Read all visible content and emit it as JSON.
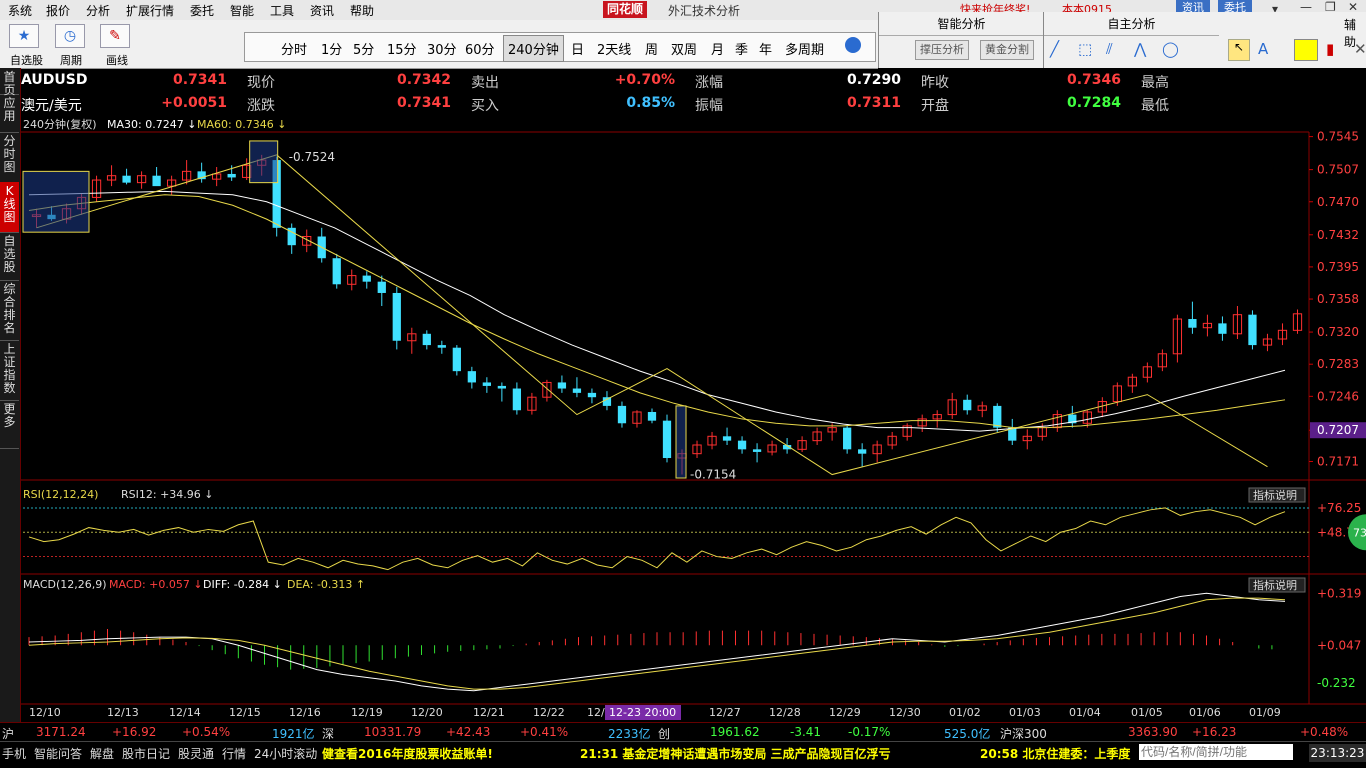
{
  "menu": [
    "系统",
    "报价",
    "分析",
    "扩展行情",
    "委托",
    "智能",
    "工具",
    "资讯",
    "帮助"
  ],
  "app": {
    "logo": "同花顺",
    "title": "外汇技术分析"
  },
  "marquee": "快来抢年终奖!",
  "top_right": {
    "user": "本本0915",
    "news": "资讯",
    "trade": "委托"
  },
  "toolbar": {
    "watchlist": "自选股",
    "cycle": "周期",
    "draw": "画线"
  },
  "periods": [
    "分时",
    "1分",
    "5分",
    "15分",
    "30分",
    "60分",
    "240分钟",
    "日",
    "2天线",
    "周",
    "双周",
    "月",
    "季",
    "年",
    "多周期"
  ],
  "active_period": "240分钟",
  "smart_panel": {
    "title": "智能分析",
    "btn1": "撑压分析",
    "btn2": "黄金分割"
  },
  "self_panel": {
    "title": "自主分析",
    "right": "辅助"
  },
  "side_tabs": [
    {
      "label": "首页",
      "active": false
    },
    {
      "label": "应用",
      "active": false
    },
    {
      "label": "分时图",
      "active": false
    },
    {
      "label": "K线图",
      "active": true
    },
    {
      "label": "自选股",
      "active": false
    },
    {
      "label": "综合排名",
      "active": false
    },
    {
      "label": "上证指数",
      "active": false
    },
    {
      "label": "更多",
      "active": false
    }
  ],
  "quote": {
    "symbol": "AUDUSD",
    "name": "澳元/美元",
    "row1": [
      {
        "label": "现价",
        "value": "0.7341",
        "color": "#ff4040"
      },
      {
        "label": "卖出",
        "value": "0.7342",
        "color": "#ff4040"
      },
      {
        "label": "涨幅",
        "value": "+0.70%",
        "color": "#ff4040"
      },
      {
        "label": "昨收",
        "value": "0.7290",
        "color": "#ffffff"
      },
      {
        "label": "最高",
        "value": "0.7346",
        "color": "#ff4040"
      }
    ],
    "row2": [
      {
        "label": "涨跌",
        "value": "+0.0051",
        "color": "#ff4040"
      },
      {
        "label": "买入",
        "value": "0.7341",
        "color": "#ff4040"
      },
      {
        "label": "振幅",
        "value": "0.85%",
        "color": "#40c0ff"
      },
      {
        "label": "开盘",
        "value": "0.7311",
        "color": "#ff4040"
      },
      {
        "label": "最低",
        "value": "0.7284",
        "color": "#40ff40"
      }
    ]
  },
  "chart_info": {
    "period_label": "240分钟(复权)",
    "ma30_label": "MA30: 0.7247",
    "ma60_label": "MA60: 0.7346",
    "high_annot": "0.7524",
    "low_annot": "0.7154",
    "current_tag": "0.7207",
    "price_ticks": [
      "0.7545",
      "0.7507",
      "0.7470",
      "0.7432",
      "0.7395",
      "0.7358",
      "0.7320",
      "0.7283",
      "0.7246",
      "0.7207",
      "0.7171"
    ],
    "rsi_label": "RSI(12,12,24)",
    "rsi12_label": "RSI12: +34.96",
    "rsi_ticks": [
      "+76.25",
      "+48.78"
    ],
    "rsi_bubble": "73",
    "macd_label": "MACD(12,26,9)",
    "macd_value": "MACD: +0.057",
    "diff": "DIFF: -0.284",
    "dea": "DEA: -0.313",
    "macd_ticks": [
      "+0.319",
      "+0.047",
      "-0.232"
    ],
    "indicator_btn": "指标说明",
    "dates": [
      "12/10",
      "12/13",
      "12/14",
      "12/15",
      "12/16",
      "12/19",
      "12/20",
      "12/21",
      "12/22",
      "12/2",
      "12/27",
      "12/28",
      "12/29",
      "12/30",
      "01/02",
      "01/03",
      "01/04",
      "01/05",
      "01/06",
      "01/09"
    ],
    "crosshair_date": "12-23 20:00"
  },
  "chart_data": {
    "type": "candlestick",
    "price_range": [
      0.7152,
      0.7548
    ],
    "candles": [
      [
        0.7453,
        0.7462,
        0.744,
        0.7455
      ],
      [
        0.7455,
        0.7465,
        0.7448,
        0.745
      ],
      [
        0.745,
        0.7468,
        0.7445,
        0.7462
      ],
      [
        0.7462,
        0.748,
        0.7455,
        0.7475
      ],
      [
        0.7475,
        0.75,
        0.747,
        0.7495
      ],
      [
        0.7495,
        0.7512,
        0.7488,
        0.75
      ],
      [
        0.75,
        0.7508,
        0.749,
        0.7492
      ],
      [
        0.7492,
        0.7505,
        0.7485,
        0.75
      ],
      [
        0.75,
        0.751,
        0.749,
        0.7488
      ],
      [
        0.7488,
        0.75,
        0.7478,
        0.7495
      ],
      [
        0.7495,
        0.7518,
        0.749,
        0.7505
      ],
      [
        0.7505,
        0.7515,
        0.7492,
        0.7496
      ],
      [
        0.7496,
        0.751,
        0.7488,
        0.7502
      ],
      [
        0.7502,
        0.7512,
        0.7494,
        0.7498
      ],
      [
        0.7498,
        0.752,
        0.7495,
        0.7512
      ],
      [
        0.7512,
        0.7524,
        0.75,
        0.7518
      ],
      [
        0.7518,
        0.7522,
        0.743,
        0.744
      ],
      [
        0.744,
        0.7445,
        0.741,
        0.742
      ],
      [
        0.742,
        0.7438,
        0.7412,
        0.743
      ],
      [
        0.743,
        0.744,
        0.74,
        0.7405
      ],
      [
        0.7405,
        0.741,
        0.737,
        0.7375
      ],
      [
        0.7375,
        0.7392,
        0.7368,
        0.7385
      ],
      [
        0.7385,
        0.739,
        0.737,
        0.7378
      ],
      [
        0.7378,
        0.7385,
        0.735,
        0.7365
      ],
      [
        0.7365,
        0.7372,
        0.73,
        0.731
      ],
      [
        0.731,
        0.7325,
        0.7295,
        0.7318
      ],
      [
        0.7318,
        0.7322,
        0.73,
        0.7305
      ],
      [
        0.7305,
        0.731,
        0.7295,
        0.7302
      ],
      [
        0.7302,
        0.7305,
        0.727,
        0.7275
      ],
      [
        0.7275,
        0.728,
        0.7255,
        0.7262
      ],
      [
        0.7262,
        0.7268,
        0.725,
        0.7258
      ],
      [
        0.7258,
        0.7262,
        0.724,
        0.7255
      ],
      [
        0.7255,
        0.7262,
        0.7225,
        0.723
      ],
      [
        0.723,
        0.725,
        0.7225,
        0.7245
      ],
      [
        0.7245,
        0.7265,
        0.724,
        0.7262
      ],
      [
        0.7262,
        0.727,
        0.725,
        0.7255
      ],
      [
        0.7255,
        0.7268,
        0.7245,
        0.725
      ],
      [
        0.725,
        0.7255,
        0.7238,
        0.7245
      ],
      [
        0.7245,
        0.7252,
        0.723,
        0.7235
      ],
      [
        0.7235,
        0.724,
        0.721,
        0.7215
      ],
      [
        0.7215,
        0.723,
        0.721,
        0.7228
      ],
      [
        0.7228,
        0.7232,
        0.7215,
        0.7218
      ],
      [
        0.7218,
        0.7225,
        0.717,
        0.7175
      ],
      [
        0.7175,
        0.7185,
        0.7156,
        0.718
      ],
      [
        0.718,
        0.7195,
        0.7175,
        0.719
      ],
      [
        0.719,
        0.7205,
        0.7185,
        0.72
      ],
      [
        0.72,
        0.721,
        0.719,
        0.7195
      ],
      [
        0.7195,
        0.72,
        0.718,
        0.7185
      ],
      [
        0.7185,
        0.7192,
        0.717,
        0.7182
      ],
      [
        0.7182,
        0.7195,
        0.7178,
        0.719
      ],
      [
        0.719,
        0.7198,
        0.718,
        0.7185
      ],
      [
        0.7185,
        0.72,
        0.7182,
        0.7195
      ],
      [
        0.7195,
        0.721,
        0.719,
        0.7205
      ],
      [
        0.7205,
        0.7215,
        0.7195,
        0.721
      ],
      [
        0.721,
        0.7212,
        0.718,
        0.7185
      ],
      [
        0.7185,
        0.7192,
        0.7165,
        0.718
      ],
      [
        0.718,
        0.7195,
        0.717,
        0.719
      ],
      [
        0.719,
        0.7205,
        0.7185,
        0.72
      ],
      [
        0.72,
        0.7215,
        0.7195,
        0.7212
      ],
      [
        0.7212,
        0.7225,
        0.7205,
        0.722
      ],
      [
        0.722,
        0.723,
        0.721,
        0.7225
      ],
      [
        0.7225,
        0.725,
        0.722,
        0.7242
      ],
      [
        0.7242,
        0.7248,
        0.7225,
        0.723
      ],
      [
        0.723,
        0.724,
        0.7222,
        0.7235
      ],
      [
        0.7235,
        0.7238,
        0.7205,
        0.721
      ],
      [
        0.721,
        0.722,
        0.719,
        0.7195
      ],
      [
        0.7195,
        0.7208,
        0.7185,
        0.72
      ],
      [
        0.72,
        0.7215,
        0.7195,
        0.721
      ],
      [
        0.721,
        0.723,
        0.7205,
        0.7225
      ],
      [
        0.7225,
        0.7235,
        0.721,
        0.7215
      ],
      [
        0.7215,
        0.723,
        0.721,
        0.7228
      ],
      [
        0.7228,
        0.7245,
        0.7222,
        0.724
      ],
      [
        0.724,
        0.7262,
        0.7235,
        0.7258
      ],
      [
        0.7258,
        0.7272,
        0.725,
        0.7268
      ],
      [
        0.7268,
        0.7285,
        0.7262,
        0.728
      ],
      [
        0.728,
        0.73,
        0.7275,
        0.7295
      ],
      [
        0.7295,
        0.734,
        0.7285,
        0.7335
      ],
      [
        0.7335,
        0.7355,
        0.7318,
        0.7325
      ],
      [
        0.7325,
        0.734,
        0.7315,
        0.733
      ],
      [
        0.733,
        0.7338,
        0.731,
        0.7318
      ],
      [
        0.7318,
        0.735,
        0.7312,
        0.734
      ],
      [
        0.734,
        0.7345,
        0.73,
        0.7305
      ],
      [
        0.7305,
        0.7318,
        0.7298,
        0.7312
      ],
      [
        0.7312,
        0.733,
        0.7305,
        0.7322
      ],
      [
        0.7322,
        0.7346,
        0.7318,
        0.7341
      ]
    ],
    "ma30": [
      0.7478,
      0.7479,
      0.748,
      0.7481,
      0.7482,
      0.748,
      0.7478,
      0.747,
      0.7455,
      0.744,
      0.742,
      0.74,
      0.738,
      0.7362,
      0.734,
      0.7322,
      0.7305,
      0.729,
      0.7275,
      0.7262,
      0.7248,
      0.7238,
      0.7228,
      0.722,
      0.7214,
      0.721,
      0.721,
      0.7208,
      0.7206,
      0.7209,
      0.7212,
      0.7218,
      0.7226,
      0.7235,
      0.7246,
      0.7256,
      0.7266,
      0.7276
    ],
    "ma60": [
      0.746,
      0.7466,
      0.747,
      0.7474,
      0.7478,
      0.7476,
      0.7466,
      0.745,
      0.743,
      0.741,
      0.739,
      0.737,
      0.735,
      0.733,
      0.7312,
      0.7295,
      0.728,
      0.7265,
      0.725,
      0.7238,
      0.7228,
      0.722,
      0.7215,
      0.7212,
      0.7212,
      0.7215,
      0.7218,
      0.7218,
      0.7215,
      0.721,
      0.721,
      0.7212,
      0.7216,
      0.722,
      0.7225,
      0.723,
      0.7236,
      0.7242
    ],
    "rsi": [
      45,
      40,
      42,
      48,
      55,
      52,
      50,
      53,
      47,
      52,
      55,
      50,
      53,
      51,
      58,
      62,
      18,
      15,
      22,
      18,
      12,
      20,
      16,
      14,
      10,
      18,
      22,
      15,
      12,
      20,
      25,
      18,
      22,
      14,
      28,
      20,
      16,
      22,
      15,
      12,
      24,
      20,
      12,
      28,
      18,
      30,
      24,
      22,
      28,
      32,
      26,
      34,
      40,
      36,
      30,
      34,
      42,
      46,
      52,
      56,
      48,
      58,
      66,
      60,
      42,
      30,
      38,
      46,
      40,
      50,
      54,
      62,
      58,
      66,
      70,
      74,
      76,
      68,
      72,
      74,
      70,
      66,
      58,
      66,
      72
    ],
    "diff": [
      0.02,
      0.025,
      0.03,
      0.04,
      0.045,
      0.05,
      0.05,
      0.04,
      0.0,
      -0.05,
      -0.1,
      -0.15,
      -0.18,
      -0.2,
      -0.22,
      -0.25,
      -0.27,
      -0.28,
      -0.26,
      -0.24,
      -0.22,
      -0.2,
      -0.18,
      -0.16,
      -0.14,
      -0.12,
      -0.1,
      -0.08,
      -0.06,
      -0.04,
      -0.02,
      0.0,
      0.02,
      0.04,
      0.03,
      0.02,
      0.04,
      0.06,
      0.09,
      0.12,
      0.15,
      0.18,
      0.22,
      0.26,
      0.3,
      0.32,
      0.3,
      0.28,
      0.27
    ],
    "dea": [
      0.0,
      0.01,
      0.015,
      0.02,
      0.03,
      0.04,
      0.045,
      0.042,
      0.03,
      0.0,
      -0.04,
      -0.08,
      -0.12,
      -0.16,
      -0.19,
      -0.22,
      -0.25,
      -0.27,
      -0.27,
      -0.26,
      -0.24,
      -0.22,
      -0.2,
      -0.18,
      -0.16,
      -0.14,
      -0.12,
      -0.1,
      -0.08,
      -0.06,
      -0.04,
      -0.02,
      0.0,
      0.02,
      0.025,
      0.025,
      0.03,
      0.04,
      0.06,
      0.08,
      0.11,
      0.14,
      0.17,
      0.2,
      0.24,
      0.28,
      0.29,
      0.29,
      0.28
    ],
    "macd_hist": [
      0.05,
      0.06,
      0.08,
      0.1,
      0.08,
      0.05,
      0.02,
      -0.03,
      -0.08,
      -0.12,
      -0.15,
      -0.14,
      -0.12,
      -0.1,
      -0.08,
      -0.06,
      -0.04,
      -0.03,
      -0.02,
      0.01,
      0.03,
      0.05,
      0.06,
      0.07,
      0.08,
      0.08,
      0.09,
      0.09,
      0.09,
      0.08,
      0.07,
      0.06,
      0.05,
      0.04,
      0.02,
      -0.01,
      0.0,
      0.02,
      0.04,
      0.05,
      0.06,
      0.07,
      0.07,
      0.08,
      0.08,
      0.06,
      0.02,
      -0.02,
      -0.03
    ]
  },
  "index_bar": [
    {
      "t": "沪",
      "c": "#ddd"
    },
    {
      "t": "3171.24",
      "c": "#ff4040"
    },
    {
      "t": "+16.92",
      "c": "#ff4040"
    },
    {
      "t": "+0.54%",
      "c": "#ff4040"
    },
    {
      "t": "1921亿",
      "c": "#40c0ff"
    },
    {
      "t": "深",
      "c": "#ddd"
    },
    {
      "t": "10331.79",
      "c": "#ff4040"
    },
    {
      "t": "+42.43",
      "c": "#ff4040"
    },
    {
      "t": "+0.41%",
      "c": "#ff4040"
    },
    {
      "t": "2233亿",
      "c": "#40c0ff"
    },
    {
      "t": "创",
      "c": "#ddd"
    },
    {
      "t": "1961.62",
      "c": "#40ff40"
    },
    {
      "t": "-3.41",
      "c": "#40ff40"
    },
    {
      "t": "-0.17%",
      "c": "#40ff40"
    },
    {
      "t": "525.0亿",
      "c": "#40c0ff"
    },
    {
      "t": "沪深300",
      "c": "#ddd"
    },
    {
      "t": "3363.90",
      "c": "#ff4040"
    },
    {
      "t": "+16.23",
      "c": "#ff4040"
    },
    {
      "t": "+0.48%",
      "c": "#ff4040"
    }
  ],
  "bottom_bar": {
    "items": [
      "手机",
      "智能问答",
      "解盘",
      "股市日记",
      "股灵通",
      "行情",
      "24小时滚动"
    ],
    "news1": "健查看2016年度股票收益账单!",
    "news2": "21:31 基金定增神话遭遇市场变局 三成产品隐现百亿浮亏",
    "news3": "20:58 北京住建委：上季度",
    "search_placeholder": "代码/名称/简拼/功能",
    "clock": "23:13:23"
  }
}
